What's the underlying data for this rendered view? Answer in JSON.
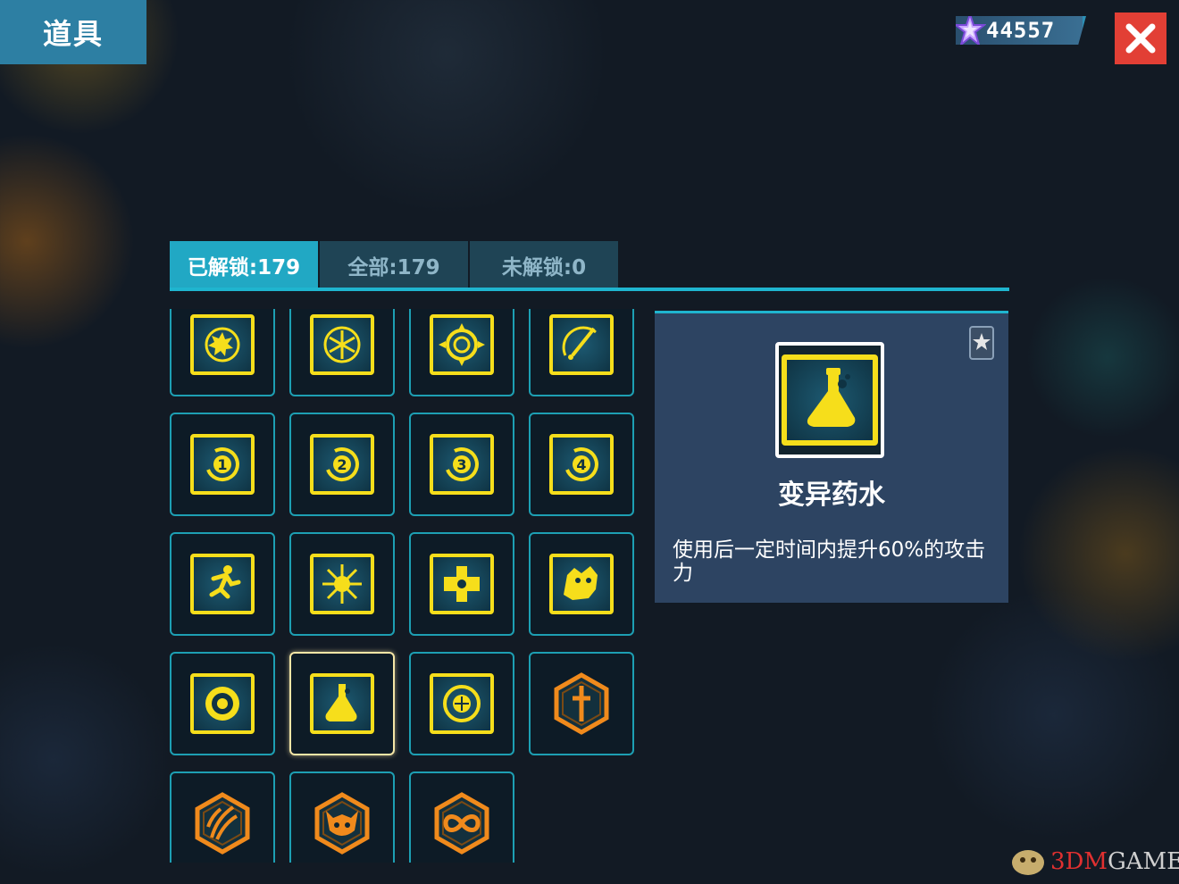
{
  "window": {
    "title": "道具"
  },
  "currency": {
    "amount": "44557",
    "icon": "star-crystal-icon"
  },
  "close": {
    "icon": "close-icon",
    "color": "#e23f35"
  },
  "tabs": [
    {
      "label": "已解锁:179",
      "active": true
    },
    {
      "label": "全部:179",
      "active": false
    },
    {
      "label": "未解锁:0",
      "active": false
    }
  ],
  "items": [
    {
      "icon": "sun-gear-icon",
      "style": "yellow-square"
    },
    {
      "icon": "snowflake-icon",
      "style": "yellow-square"
    },
    {
      "icon": "spiral-target-icon",
      "style": "yellow-square"
    },
    {
      "icon": "sword-slash-icon",
      "style": "yellow-square"
    },
    {
      "icon": "level-1-icon",
      "style": "yellow-square",
      "text": "1"
    },
    {
      "icon": "level-2-icon",
      "style": "yellow-square",
      "text": "2"
    },
    {
      "icon": "level-3-icon",
      "style": "yellow-square",
      "text": "3"
    },
    {
      "icon": "level-4-icon",
      "style": "yellow-square",
      "text": "4"
    },
    {
      "icon": "running-man-icon",
      "style": "yellow-square"
    },
    {
      "icon": "starburst-icon",
      "style": "yellow-square"
    },
    {
      "icon": "cross-shield-icon",
      "style": "yellow-square"
    },
    {
      "icon": "beast-head-icon",
      "style": "yellow-square"
    },
    {
      "icon": "eye-orb-icon",
      "style": "yellow-square"
    },
    {
      "icon": "potion-flask-icon",
      "style": "yellow-square",
      "selected": true
    },
    {
      "icon": "frost-orb-icon",
      "style": "yellow-square"
    },
    {
      "icon": "dagger-hex-icon",
      "style": "orange-hex"
    },
    {
      "icon": "claw-hex-icon",
      "style": "orange-hex"
    },
    {
      "icon": "demon-face-hex-icon",
      "style": "orange-hex"
    },
    {
      "icon": "infinity-hex-icon",
      "style": "orange-hex"
    }
  ],
  "detail": {
    "name": "变异药水",
    "description": "使用后一定时间内提升60%的攻击力",
    "icon": "potion-flask-icon",
    "badge_icon": "star-badge-icon"
  },
  "watermark": {
    "prefix": "3DM",
    "suffix": "GAME",
    "icon": "mascot-icon"
  },
  "colors": {
    "accent": "#1fb5cf",
    "tab_active": "#21a8c4",
    "icon_yellow": "#f6de1b",
    "hex_orange": "#f08a1c",
    "panel": "#2d4462"
  }
}
